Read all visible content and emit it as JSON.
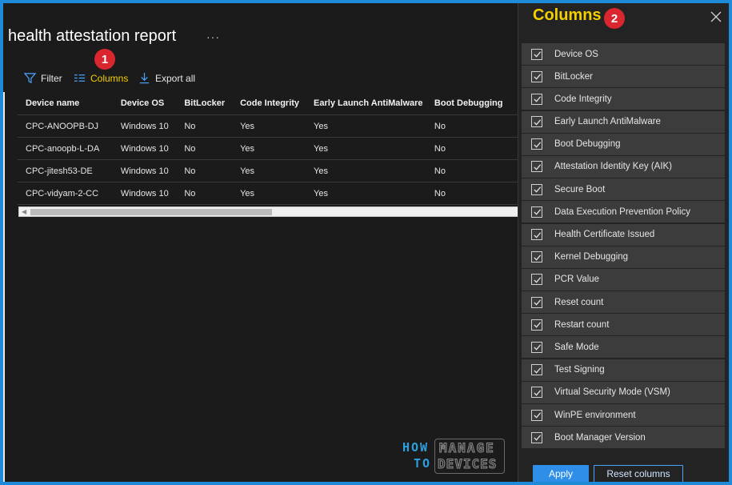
{
  "page": {
    "title": "health attestation report",
    "more": "···"
  },
  "toolbar": {
    "filter_label": "Filter",
    "columns_label": "Columns",
    "export_label": "Export all"
  },
  "badges": {
    "one": "1",
    "two": "2"
  },
  "table": {
    "headers": [
      "Device name",
      "Device OS",
      "BitLocker",
      "Code Integrity",
      "Early Launch AntiMalware",
      "Boot Debugging"
    ],
    "rows": [
      [
        "CPC-ANOOPB-DJ",
        "Windows 10",
        "No",
        "Yes",
        "Yes",
        "No"
      ],
      [
        "CPC-anoopb-L-DA",
        "Windows 10",
        "No",
        "Yes",
        "Yes",
        "No"
      ],
      [
        "CPC-jitesh53-DE",
        "Windows 10",
        "No",
        "Yes",
        "Yes",
        "No"
      ],
      [
        "CPC-vidyam-2-CC",
        "Windows 10",
        "No",
        "Yes",
        "Yes",
        "No"
      ]
    ]
  },
  "panel": {
    "title": "Columns",
    "items": [
      "Device OS",
      "BitLocker",
      "Code Integrity",
      "Early Launch AntiMalware",
      "Boot Debugging",
      "Attestation Identity Key (AIK)",
      "Secure Boot",
      "Data Execution Prevention Policy",
      "Health Certificate Issued",
      "Kernel Debugging",
      "PCR Value",
      "Reset count",
      "Restart count",
      "Safe Mode",
      "Test Signing",
      "Virtual Security Mode (VSM)",
      "WinPE environment",
      "Boot Manager Version"
    ],
    "apply_label": "Apply",
    "reset_label": "Reset columns"
  },
  "logo": {
    "how": "HOW",
    "to": "TO",
    "manage": "MANAGE",
    "devices": "DEVICES"
  },
  "colors": {
    "accent": "#f5d000",
    "badge": "#d9262f",
    "primary": "#2e8ee8",
    "frame": "#1f8ad8"
  }
}
